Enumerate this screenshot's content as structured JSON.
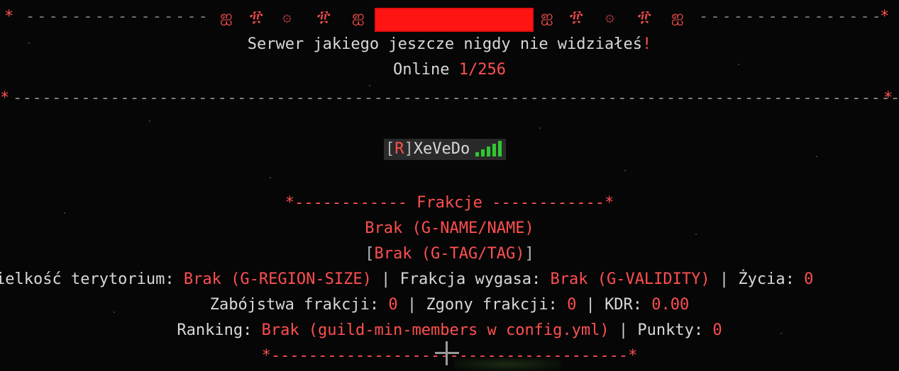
{
  "header": {
    "left_star": "*",
    "right_star": "*",
    "dashes": "----------------",
    "glyphs_left": [
      "ஐ",
      "፹",
      "۞",
      "፹",
      "ஐ"
    ],
    "glyphs_right": [
      "ஐ",
      "፹",
      "۞",
      "፹",
      "ஐ"
    ]
  },
  "motd": {
    "line1_text": "Serwer jakiego jeszcze nigdy nie widziałeś",
    "line1_mark": "!",
    "online_label": "Online ",
    "online_value": "1/256"
  },
  "separator": {
    "star": "*",
    "dashes": "--------------------------------------------------------------------------------------------------------------------------------------------------------------------------"
  },
  "player": {
    "bracket_open": "[",
    "rank": "R",
    "bracket_close": "]",
    "name": "XeVeDo"
  },
  "faction": {
    "title_left": "*------------ ",
    "title": "Frakcje",
    "title_right": " ------------*",
    "name": "Brak (G-NAME/NAME)",
    "tag_open": "[",
    "tag": "Brak (G-TAG/TAG)",
    "tag_close": "]",
    "territory_label": "ielkość terytorium: ",
    "territory_value": "Brak (G-REGION-SIZE)",
    "sep": " | ",
    "expires_label": "Frakcja wygasa: ",
    "expires_value": "Brak (G-VALIDITY)",
    "lives_label": "Życia: ",
    "lives_value": "0",
    "kills_label": "Zabójstwa frakcji: ",
    "kills_value": "0",
    "deaths_label": "Zgony frakcji: ",
    "deaths_value": "0",
    "kdr_label": "KDR: ",
    "kdr_value": "0.00",
    "ranking_label": "Ranking: ",
    "ranking_value": "Brak (guild-min-members w config.yml)",
    "points_label": "Punkty: ",
    "points_value": "0",
    "footer_left": "*-------------------",
    "footer_right": "-------------------*"
  },
  "colors": {
    "accent": "#ff4f4f",
    "text": "#d8d8d8",
    "background": "#060606",
    "signal": "#2fc82f",
    "redacted": "#ff1414"
  }
}
